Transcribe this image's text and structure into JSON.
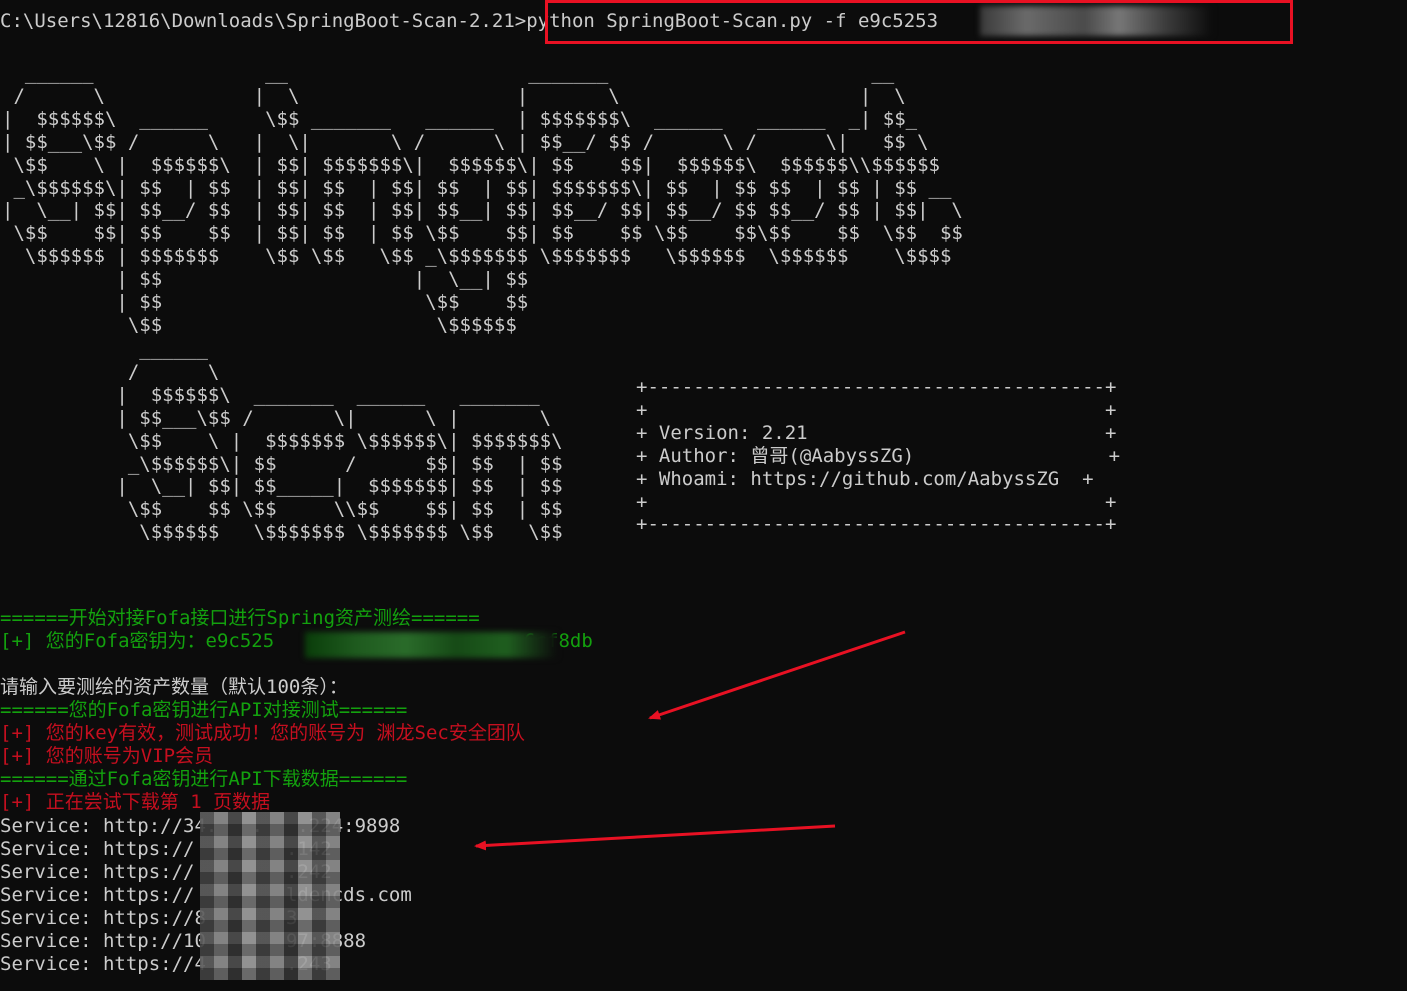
{
  "command": {
    "prompt": "C:\\Users\\12816\\Downloads\\SpringBoot-Scan-2.21",
    "separator": ">",
    "text_prefix": "python SpringBoot-Scan.py -f e9c5253",
    "text_suffix": "0cf8db"
  },
  "banner": {
    "spring_boot_art": "  ______               __                     _______                       __\n /      \\             |  \\                   |       \\                     |  \\\n|  $$$$$$\\  ______     \\$$ _______   ______  | $$$$$$$\\  ______   ______  _| $$_\n| $$___\\$$ /      \\   |  \\|       \\ /      \\ | $$__/ $$ /      \\ /      \\|   $$ \\\n \\$$    \\ |  $$$$$$\\  | $$| $$$$$$$\\|  $$$$$$\\| $$    $$|  $$$$$$\\  $$$$$$\\\\$$$$$$\n _\\$$$$$$\\| $$  | $$  | $$| $$  | $$| $$  | $$| $$$$$$$\\| $$  | $$ $$  | $$ | $$ __\n|  \\__| $$| $$__/ $$  | $$| $$  | $$| $$__| $$| $$__/ $$| $$__/ $$ $$__/ $$ | $$|  \\\n \\$$    $$| $$    $$  | $$| $$  | $$ \\$$    $$| $$    $$ \\$$    $$\\$$    $$  \\$$  $$\n  \\$$$$$$ | $$$$$$$    \\$$ \\$$   \\$$ _\\$$$$$$$ \\$$$$$$$   \\$$$$$$  \\$$$$$$    \\$$$$\n          | $$                      |  \\__| $$\n          | $$                       \\$$    $$\n           \\$$                        \\$$$$$$",
    "scan_art": "            ______\n           /      \\\n          |  $$$$$$\\  _______  ______   _______\n          | $$___\\$$ /       \\|      \\ |       \\\n           \\$$    \\ |  $$$$$$$ \\$$$$$$\\| $$$$$$$\\\n           _\\$$$$$$\\| $$      /      $$| $$  | $$\n          |  \\__| $$| $$_____|  $$$$$$$| $$  | $$\n           \\$$    $$ \\$$     \\\\$$    $$| $$  | $$\n            \\$$$$$$   \\$$$$$$$ \\$$$$$$$ \\$$   \\$$",
    "info_box_art": "+----------------------------------------+\n+                                        +\n+ Version: 2.21                          +\n+ Author: 曾哥(@AabyssZG)                 +\n+ Whoami: https://github.com/AabyssZG  +\n+                                        +\n+----------------------------------------+"
  },
  "output": {
    "fofa_start": "======开始对接Fofa接口进行Spring资产测绘======",
    "fofa_key_prefix": "[+] 您的Fofa密钥为：e9c525",
    "fofa_key_suffix": "6cf8db",
    "asset_prompt": "请输入要测绘的资产数量（默认100条）：",
    "api_test": "======您的Fofa密钥进行API对接测试======",
    "key_valid": "[+] 您的key有效，测试成功！您的账号为 渊龙Sec安全团队",
    "vip": "[+] 您的账号为VIP会员",
    "download_start": "======通过Fofa密钥进行API下载数据======",
    "downloading": "[+] 正在尝试下载第 1 页数据",
    "services": [
      "Service: http://34.   .   .224:9898",
      "Service: https://        .142",
      "Service: https://        .242",
      "Service: https://        ldencds.com",
      "Service: https://8       3",
      "Service: http://10       97:8888",
      "Service: https://4       .243"
    ]
  },
  "colors": {
    "background": "#0c0c0c",
    "text": "#cccccc",
    "green": "#13a10e",
    "red": "#c50f1f",
    "annotation": "#e81123"
  }
}
